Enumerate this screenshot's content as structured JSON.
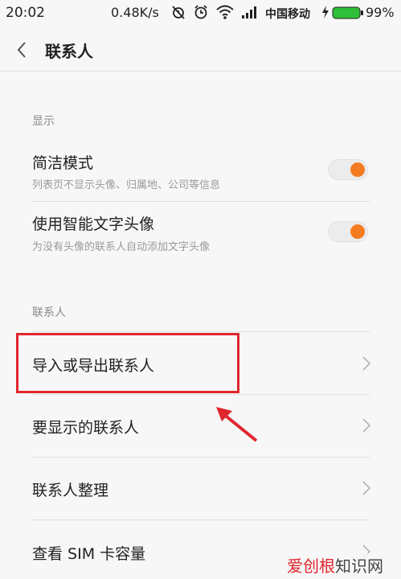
{
  "status_bar": {
    "time": "20:02",
    "speed": "0.48K/s",
    "carrier": "中国移动",
    "battery": "99%"
  },
  "header": {
    "back_icon": "chevron-left-icon",
    "title": "联系人"
  },
  "sections": {
    "display": {
      "header": "显示",
      "simple_mode": {
        "label": "简洁模式",
        "sub": "列表页不显示头像、归属地、公司等信息",
        "on": true
      },
      "text_avatar": {
        "label": "使用智能文字头像",
        "sub": "为没有头像的联系人自动添加文字头像",
        "on": true
      }
    },
    "contacts": {
      "header": "联系人",
      "items": [
        {
          "label": "导入或导出联系人"
        },
        {
          "label": "要显示的联系人"
        },
        {
          "label": "联系人整理"
        },
        {
          "label": "查看 SIM 卡容量"
        }
      ]
    }
  },
  "watermark": {
    "part1": "爱创根",
    "part2": "知识网"
  },
  "colors": {
    "accent": "#f47c20",
    "highlight": "#e0262e"
  }
}
